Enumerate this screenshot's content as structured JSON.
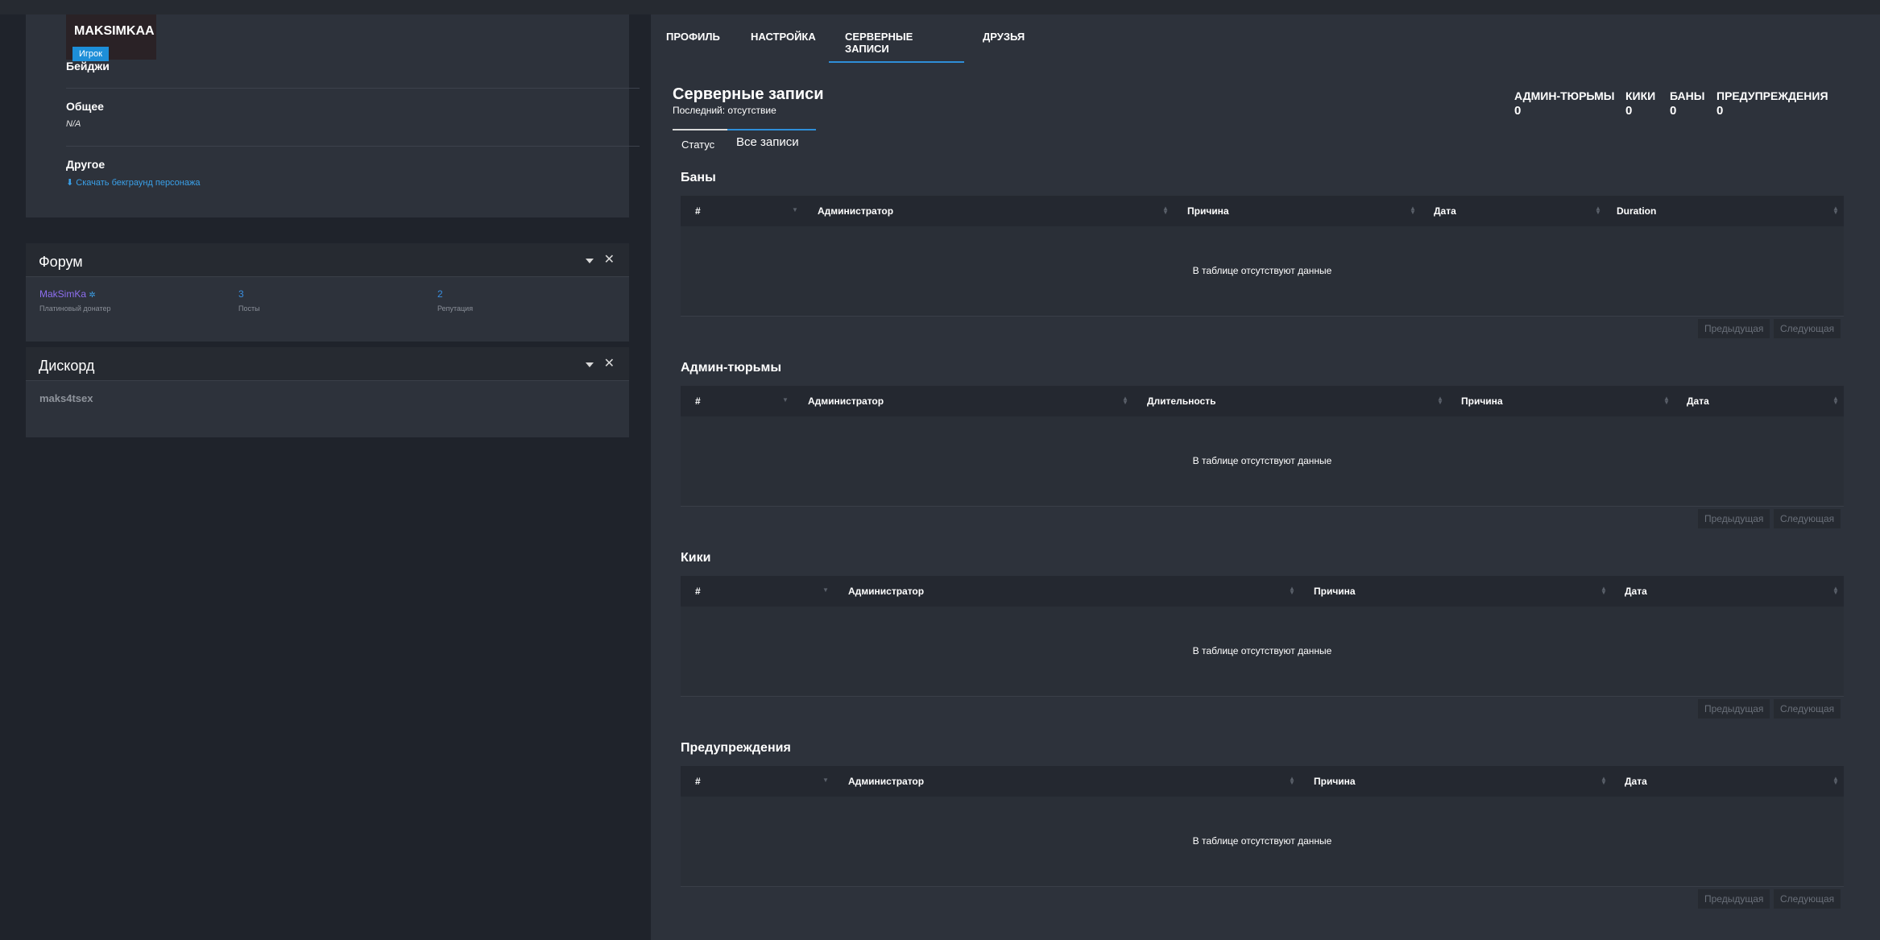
{
  "profile": {
    "username": "MAKSIMKAA",
    "role": "Игрок",
    "badges_title": "Бейджи",
    "general_title": "Общее",
    "general_value": "N/A",
    "other_title": "Другое",
    "download_link": "Скачать бекграунд персонажа"
  },
  "forum": {
    "title": "Форум",
    "username": "MakSimKa",
    "user_rank": "Платиновый донатер",
    "posts_value": "3",
    "posts_label": "Посты",
    "rep_value": "2",
    "rep_label": "Репутация"
  },
  "discord": {
    "title": "Дискорд",
    "username": "maks4tsex"
  },
  "nav": {
    "tabs": [
      "ПРОФИЛЬ",
      "НАСТРОЙКА",
      "СЕРВЕРНЫЕ ЗАПИСИ",
      "ДРУЗЬЯ"
    ],
    "active": "СЕРВЕРНЫЕ ЗАПИСИ"
  },
  "records": {
    "title": "Серверные записи",
    "subtitle": "Последний: отсутствие",
    "stats": [
      {
        "label": "АДМИН-ТЮРЬМЫ",
        "value": "0"
      },
      {
        "label": "КИКИ",
        "value": "0"
      },
      {
        "label": "БАНЫ",
        "value": "0"
      },
      {
        "label": "ПРЕДУПРЕЖДЕНИЯ",
        "value": "0"
      }
    ],
    "subtabs": [
      "Статус",
      "Все записи"
    ]
  },
  "tables": [
    {
      "title": "Баны",
      "columns": [
        "#",
        "Администратор",
        "Причина",
        "Дата",
        "Duration"
      ],
      "empty": "В таблице отсутствуют данные"
    },
    {
      "title": "Админ-тюрьмы",
      "columns": [
        "#",
        "Администратор",
        "Длительность",
        "Причина",
        "Дата"
      ],
      "empty": "В таблице отсутствуют данные"
    },
    {
      "title": "Кики",
      "columns": [
        "#",
        "Администратор",
        "Причина",
        "Дата"
      ],
      "empty": "В таблице отсутствуют данные"
    },
    {
      "title": "Предупреждения",
      "columns": [
        "#",
        "Администратор",
        "Причина",
        "Дата"
      ],
      "empty": "В таблице отсутствуют данные"
    }
  ],
  "pager": {
    "prev": "Предыдущая",
    "next": "Следующая"
  },
  "colors": {
    "accent": "#2e8ed8",
    "background": "#1f232b",
    "panel": "#2d323b"
  }
}
